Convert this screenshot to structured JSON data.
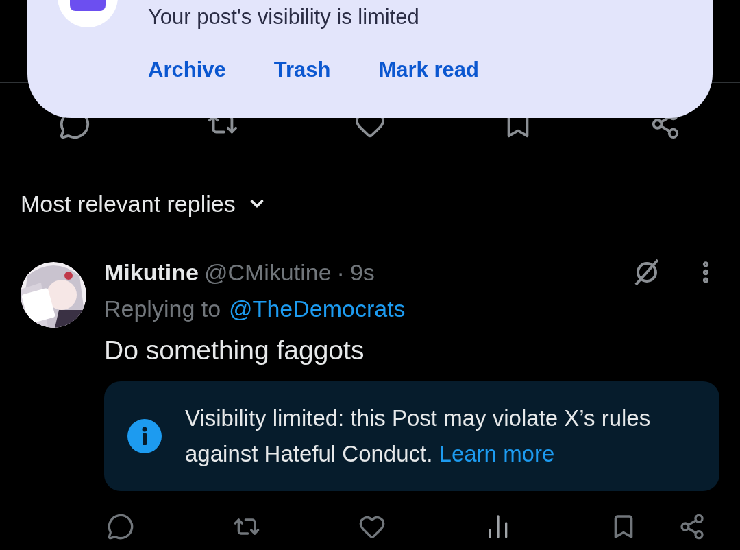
{
  "notification": {
    "message": "Your post's visibility is limited",
    "actions": [
      "Archive",
      "Trash",
      "Mark read"
    ]
  },
  "sort": {
    "label": "Most relevant replies"
  },
  "reply": {
    "name": "Mikutine",
    "handle": "@CMikutine",
    "separator": "·",
    "time": "9s",
    "replying_prefix": "Replying to",
    "replying_to": "@TheDemocrats",
    "text": "Do something faggots",
    "notice": {
      "text": "Visibility limited: this Post may violate X’s rules against Hateful Conduct.",
      "link": "Learn more"
    }
  }
}
